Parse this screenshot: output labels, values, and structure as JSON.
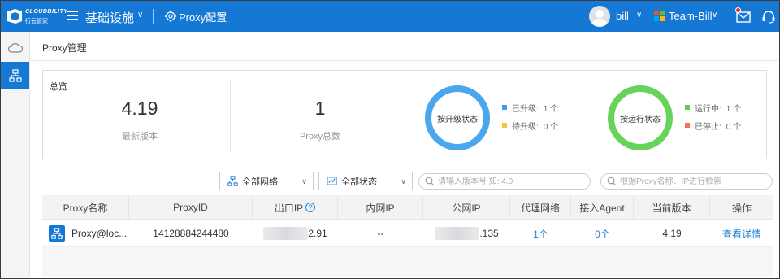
{
  "app": {
    "logo_text": "CLOUDBILITY",
    "logo_sub": "行云管家",
    "module_title": "基础设施",
    "config_link": "Proxy配置",
    "user_name": "bill",
    "team_name": "Team-Bill"
  },
  "breadcrumb": {
    "title": "Proxy管理"
  },
  "overview": {
    "title": "总览",
    "latest_version": {
      "value": "4.19",
      "label": "最新版本"
    },
    "proxy_total": {
      "value": "1",
      "label": "Proxy总数"
    },
    "upgrade_ring": {
      "label": "按升级状态",
      "items": [
        {
          "label": "已升级:",
          "count": "1 个",
          "color": "#3a9ff0"
        },
        {
          "label": "待升级:",
          "count": "0 个",
          "color": "#f5c342"
        }
      ]
    },
    "run_ring": {
      "label": "按运行状态",
      "items": [
        {
          "label": "运行中:",
          "count": "1 个",
          "color": "#5fcf52"
        },
        {
          "label": "已停止:",
          "count": "0 个",
          "color": "#f0705a"
        }
      ]
    }
  },
  "filters": {
    "network": "全部网络",
    "status": "全部状态",
    "search_version_placeholder": "请输入版本号 如: 4.0",
    "search_name_placeholder": "根据Proxy名称、IP进行检索"
  },
  "table": {
    "headers": [
      "Proxy名称",
      "ProxyID",
      "出口IP",
      "内网IP",
      "公网IP",
      "代理网络",
      "接入Agent",
      "当前版本",
      "操作"
    ],
    "rows": [
      {
        "name": "Proxy@loc...",
        "id": "14128884244480",
        "exit_ip_suffix": "2.91",
        "intranet_ip": "--",
        "public_ip_suffix": ".135",
        "network": "1个",
        "agent": "0个",
        "version": "4.19",
        "action": "查看详情"
      }
    ]
  },
  "colors": {
    "primary": "#1578d4",
    "ring_blue": "#4aa7ee",
    "ring_green": "#67d35a"
  }
}
